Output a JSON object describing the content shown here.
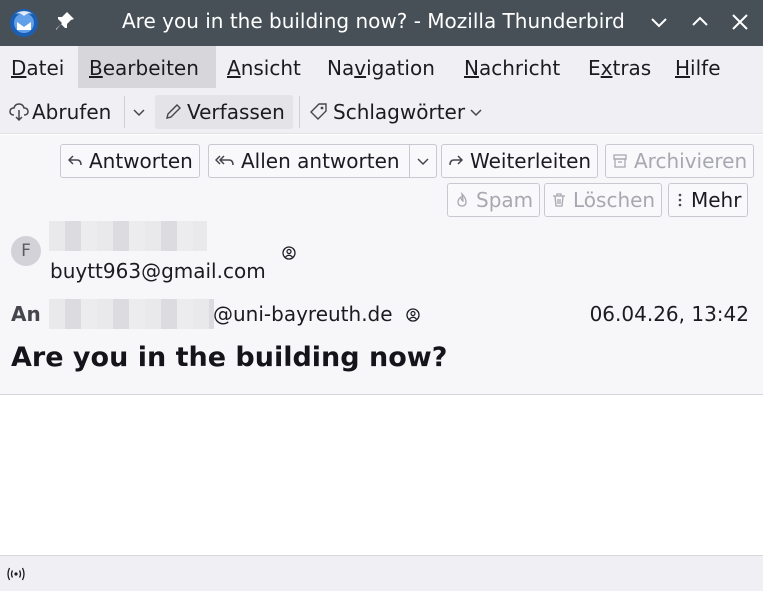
{
  "window": {
    "title": "Are you in the building now? - Mozilla Thunderbird"
  },
  "menubar": {
    "items": [
      {
        "label": "Datei",
        "accel": "D"
      },
      {
        "label": "Bearbeiten",
        "accel": "B"
      },
      {
        "label": "Ansicht",
        "accel": "A"
      },
      {
        "label": "Navigation",
        "accel": "v"
      },
      {
        "label": "Nachricht",
        "accel": "N"
      },
      {
        "label": "Extras",
        "accel": "x"
      },
      {
        "label": "Hilfe",
        "accel": "H"
      }
    ],
    "active_index": 1
  },
  "toolbar": {
    "get_messages": "Abrufen",
    "write": "Verfassen",
    "tags": "Schlagwörter"
  },
  "header_actions": {
    "reply": "Antworten",
    "reply_all": "Allen antworten",
    "forward": "Weiterleiten",
    "archive": "Archivieren",
    "junk": "Spam",
    "delete": "Löschen",
    "more": "Mehr"
  },
  "message": {
    "avatar_initial": "F",
    "from_email": "buytt963@gmail.com",
    "to_label": "An",
    "to_domain": "@uni-bayreuth.de",
    "date": "06.04.26, 13:42",
    "subject": "Are you in the building now?"
  },
  "icons": {
    "app": "thunderbird-icon",
    "pin": "pin-icon",
    "status": "online-status-icon"
  },
  "colors": {
    "titlebar": "#475057",
    "menubar": "#f0f0f4",
    "disabled_text": "#a8a8b0"
  }
}
